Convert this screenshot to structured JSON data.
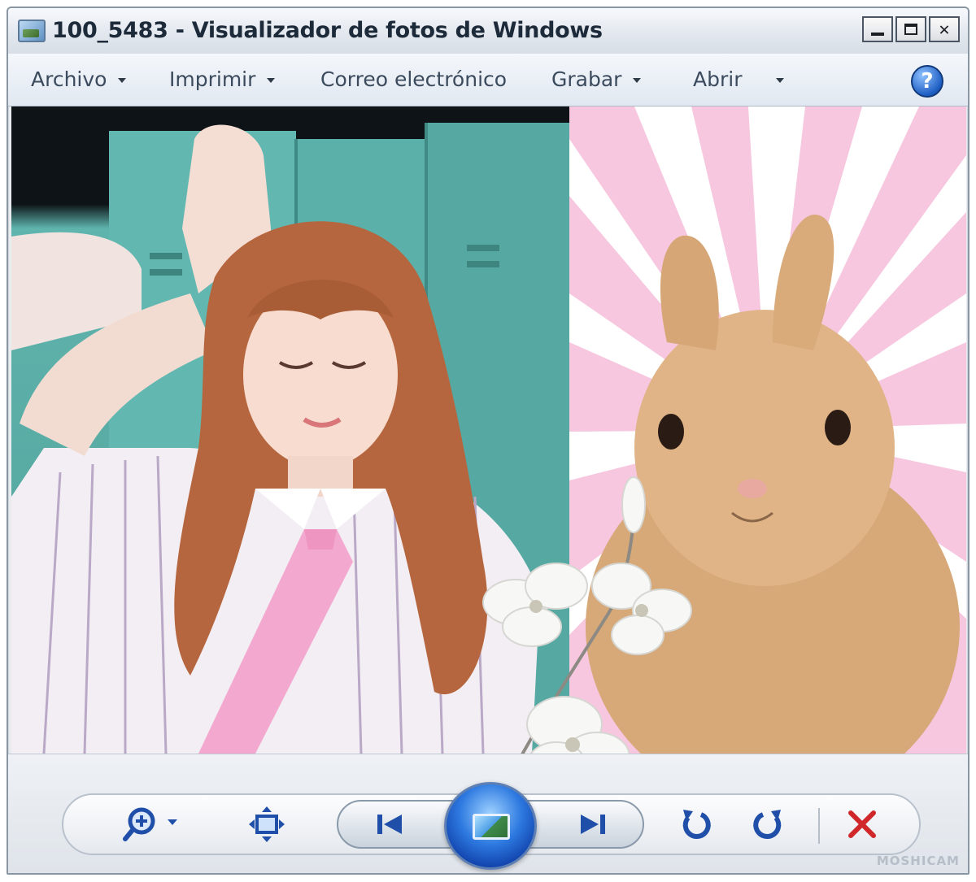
{
  "window": {
    "title": "100_5483 - Visualizador de fotos de Windows",
    "controls": {
      "minimize": "_",
      "maximize": "□",
      "close": "✕"
    }
  },
  "menu": {
    "items": [
      {
        "label": "Archivo",
        "has_dropdown": true
      },
      {
        "label": "Imprimir",
        "has_dropdown": true
      },
      {
        "label": "Correo electrónico",
        "has_dropdown": false
      },
      {
        "label": "Grabar",
        "has_dropdown": true
      },
      {
        "label": "Abrir",
        "has_dropdown": true
      }
    ],
    "help": "?"
  },
  "photo": {
    "left_panel": "girl-in-striped-shirt-pink-tie",
    "right_panel": "rabbit-on-pink-sunburst",
    "overlay": "white-flower-branch"
  },
  "toolbar": {
    "tools": [
      "zoom-icon",
      "fit-to-window-icon",
      "previous-icon",
      "slideshow-icon",
      "next-icon",
      "rotate-counterclockwise-icon",
      "rotate-clockwise-icon",
      "delete-icon"
    ]
  },
  "watermark": "MOSHICAM",
  "colors": {
    "title_bar": "#e3e8ef",
    "menu_text": "#3b4a5c",
    "slideshow_blue": "#2d79e0",
    "icon_blue": "#1f4fa8",
    "delete_red": "#d0272a",
    "sunburst_pink": "#f6c7df"
  }
}
